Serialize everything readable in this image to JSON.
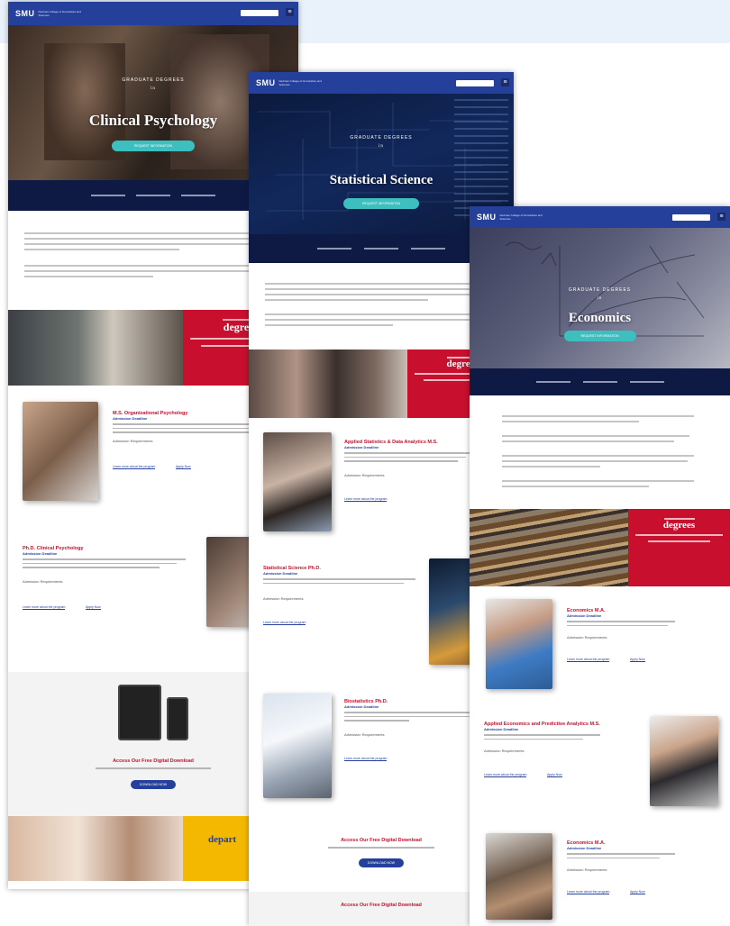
{
  "brand": {
    "logo": "SMU",
    "tagline": "Dedman College of Humanities and Sciences"
  },
  "pages": {
    "clinical": {
      "kicker": "GRADUATE DEGREES",
      "in_word": "in",
      "title": "Clinical Psychology",
      "cta": "REQUEST INFORMATION",
      "programs": [
        {
          "title": "M.S. Organizational Psychology",
          "sub": "Admission Deadline",
          "req": "Admission Requirements",
          "link1": "Learn more about the program",
          "link2": "Apply Now"
        },
        {
          "title": "Ph.D. Clinical Psychology",
          "sub": "Admission Deadline",
          "req": "Admission Requirements",
          "link1": "Learn more about the program",
          "link2": "Apply Now"
        }
      ],
      "promo_word": "degrees",
      "download_title": "Access Our Free Digital Download",
      "download_btn": "DOWNLOAD NOW",
      "yellow_word": "depart"
    },
    "statistical": {
      "kicker": "GRADUATE DEGREES",
      "in_word": "in",
      "title": "Statistical Science",
      "cta": "REQUEST INFORMATION",
      "programs": [
        {
          "title": "Applied Statistics & Data Analytics M.S.",
          "sub": "Admission Deadline",
          "req": "Admission Requirements",
          "link1": "Learn more about the program"
        },
        {
          "title": "Statistical Science Ph.D.",
          "sub": "Admission Deadline",
          "req": "Admission Requirements",
          "link1": "Learn more about the program"
        },
        {
          "title": "Biostatistics Ph.D.",
          "sub": "Admission Deadline",
          "req": "Admission Requirements",
          "link1": "Learn more about the program"
        }
      ],
      "promo_word": "degree",
      "download_title": "Access Our Free Digital Download",
      "download_btn": "DOWNLOAD NOW"
    },
    "economics": {
      "kicker": "GRADUATE DEGREES",
      "in_word": "in",
      "title": "Economics",
      "cta": "REQUEST INFORMATION",
      "programs": [
        {
          "title": "Economics M.A.",
          "sub": "Admission Deadline",
          "req": "Admission Requirements",
          "link1": "Learn more about the program",
          "link2": "Apply Now"
        },
        {
          "title": "Applied Economics and Predictive Analytics M.S.",
          "sub": "Admission Deadline",
          "req": "Admission Requirements",
          "link1": "Learn more about the program",
          "link2": "Apply Now"
        },
        {
          "title": "Economics M.A.",
          "sub": "Admission Deadline",
          "req": "Admission Requirements",
          "link1": "Learn more about the program",
          "link2": "Apply Now"
        }
      ],
      "promo_word": "degrees"
    }
  },
  "colors": {
    "brand_blue": "#25409a",
    "brand_red": "#c8102e",
    "teal": "#3dbfbf",
    "gold": "#f5b800",
    "navy": "#0f1a44"
  }
}
